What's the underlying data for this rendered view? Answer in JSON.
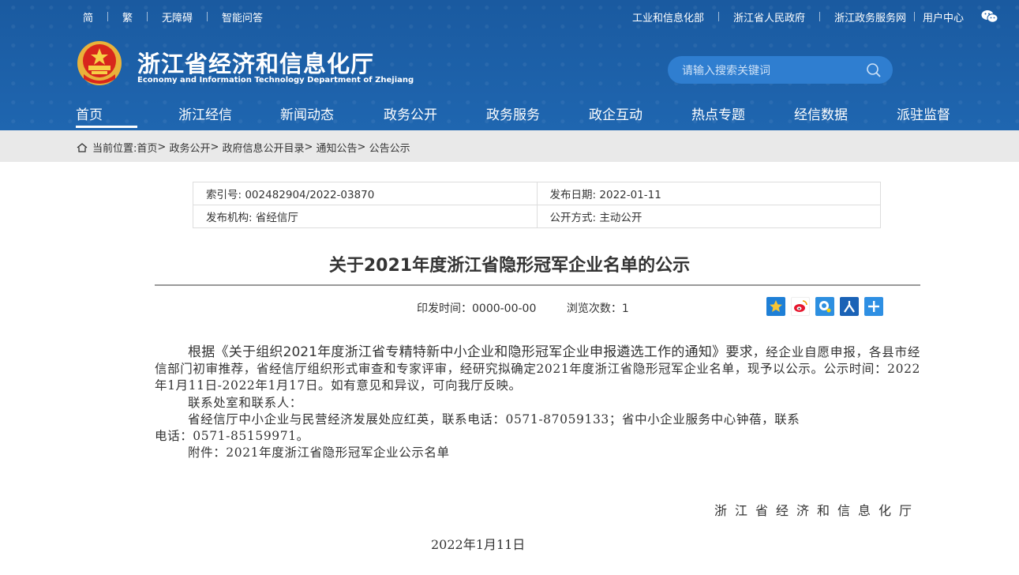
{
  "topbar": {
    "left": [
      "简",
      "繁",
      "无障碍",
      "智能问答"
    ],
    "right": [
      "工业和信息化部",
      "浙江省人民政府",
      "浙江政务服务网",
      "用户中心"
    ]
  },
  "site": {
    "title": "浙江省经济和信息化厅",
    "subtitle": "Economy and Information Technology Department of Zhejiang"
  },
  "search": {
    "placeholder": "请输入搜索关键词"
  },
  "nav": [
    "首页",
    "浙江经信",
    "新闻动态",
    "政务公开",
    "政务服务",
    "政企互动",
    "热点专题",
    "经信数据",
    "派驻监督"
  ],
  "breadcrumb": {
    "prefix": "当前位置:",
    "items": [
      "首页",
      "政务公开",
      "政府信息公开目录",
      "通知公告",
      "公告公示"
    ]
  },
  "meta": {
    "index": "索引号: 002482904/2022-03870",
    "publish_date": "发布日期: 2022-01-11",
    "org": "发布机构: 省经信厅",
    "open_mode": "公开方式: 主动公开"
  },
  "article": {
    "title": "关于2021年度浙江省隐形冠军企业名单的公示",
    "print_time": "印发时间：0000-00-00",
    "views": "浏览次数：1",
    "p1_lead": "根据《关于组织2021年度浙江省专精特新中小企业和隐形冠军企业申报遴选工作的通知》要求",
    "p1_rest": "，经企业自愿申报，各县市经信部门初审推荐，省经信厅组织形式审查和专家评审，经研究拟确定2021年度浙江省隐形冠军企业名单，现予以公示。公示时间：2022年1月11日-2022年1月17日。如有意见和异议，可向我厅反映。",
    "contact_head": "联系处室和联系人：",
    "contact_line1": "省经信厅中小企业与民营经济发展处应红英，联系电话：0571-87059133；省中小企业服务中心钟蓓，联系",
    "contact_line2": "电话：0571-85159971。",
    "attachment": "附件：2021年度浙江省隐形冠军企业公示名单",
    "signature": "浙江省经济和信息化厅",
    "date": "2022年1月11日"
  },
  "colors": {
    "header": "#1b5ea6",
    "search": "#2f7ed0",
    "crumb_bg": "#e9e9e9"
  },
  "icons": [
    "wechat-icon",
    "emblem-icon",
    "search-icon",
    "home-icon",
    "favorite-icon",
    "weibo-icon",
    "qq-icon",
    "renren-icon",
    "more-share-icon"
  ]
}
